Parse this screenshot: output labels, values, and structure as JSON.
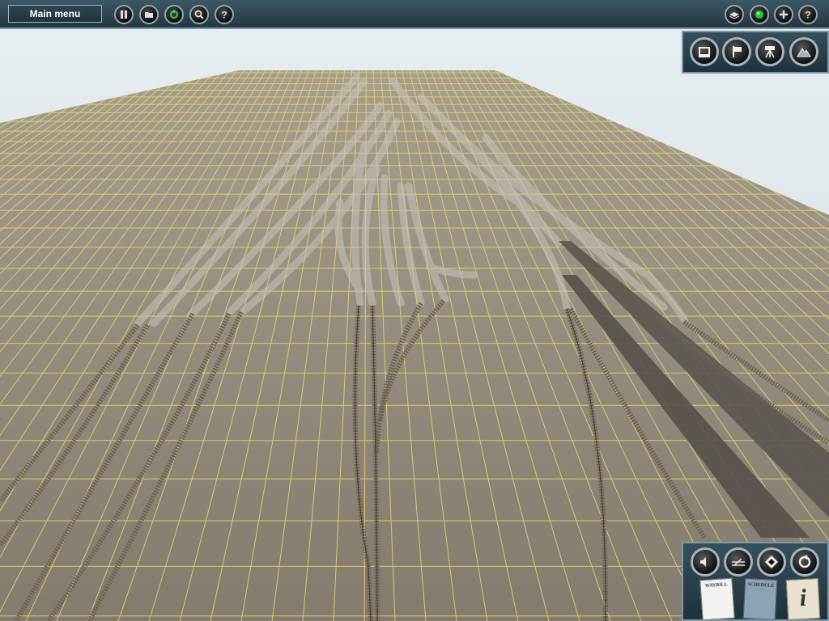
{
  "toolbar": {
    "main_menu_label": "Main menu",
    "left_buttons": [
      "pause-icon",
      "folder-icon",
      "refresh-icon",
      "magnifier-icon",
      "help-icon"
    ],
    "right_buttons": [
      "layers-icon",
      "green-light-icon",
      "plus-icon",
      "help-icon"
    ]
  },
  "view_panel": {
    "buttons": [
      "screen-icon",
      "flag-icon",
      "camera-tripod-icon",
      "mountain-icon"
    ]
  },
  "control_panel": {
    "buttons": [
      "speaker-icon",
      "track-switch-icon",
      "diamond-icon",
      "loop-icon"
    ],
    "cards": [
      {
        "icon": "newspaper-icon",
        "label": "WAYBILL"
      },
      {
        "icon": "schedule-icon",
        "label": "SCHEDULE"
      },
      {
        "icon": "info-icon",
        "label": "i"
      }
    ]
  },
  "colors": {
    "sky": "#dfe6ea",
    "ground": "#8b8374",
    "grid": "#f2e070",
    "rail": "#6a5e52",
    "toolbar": "#2e4653"
  }
}
